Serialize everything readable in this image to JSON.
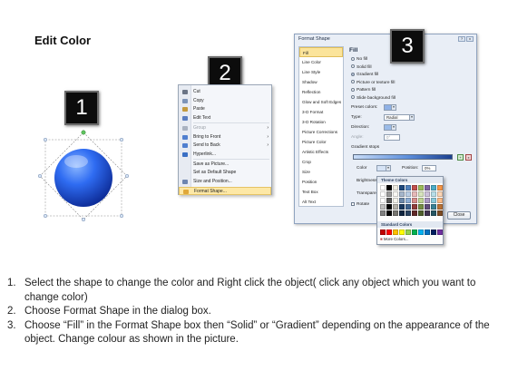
{
  "title": "Edit Color",
  "badges": [
    "1",
    "2",
    "3"
  ],
  "context_menu": {
    "items": [
      {
        "label": "Cut",
        "icon": "scissors-icon",
        "color": "#6a7485"
      },
      {
        "label": "Copy",
        "icon": "copy-icon",
        "color": "#7d94b8"
      },
      {
        "label": "Paste",
        "icon": "paste-icon",
        "color": "#c49a3e"
      },
      {
        "label": "Edit Text",
        "icon": "edit-text-icon",
        "color": "#5a7ec0"
      },
      {
        "label": "Group",
        "icon": "group-icon",
        "color": "#a9b2c0",
        "disabled": true,
        "submenu": true
      },
      {
        "label": "Bring to Front",
        "icon": "bring-front-icon",
        "color": "#4f7fcf",
        "submenu": true
      },
      {
        "label": "Send to Back",
        "icon": "send-back-icon",
        "color": "#4f7fcf",
        "submenu": true
      },
      {
        "label": "Hyperlink...",
        "icon": "hyperlink-icon",
        "color": "#3a6fc4"
      },
      {
        "label": "Save as Picture...",
        "icon": "",
        "color": ""
      },
      {
        "label": "Set as Default Shape",
        "icon": "",
        "color": ""
      },
      {
        "label": "Size and Position...",
        "icon": "size-position-icon",
        "color": "#6d86b0"
      },
      {
        "label": "Format Shape...",
        "icon": "format-shape-icon",
        "color": "#e0a83a",
        "highlighted": true
      }
    ]
  },
  "dialog": {
    "title": "Format Shape",
    "win_buttons": [
      "?",
      "x"
    ],
    "categories": [
      "Fill",
      "Line Color",
      "Line Style",
      "Shadow",
      "Reflection",
      "Glow and Soft Edges",
      "3-D Format",
      "3-D Rotation",
      "Picture Corrections",
      "Picture Color",
      "Artistic Effects",
      "Crop",
      "Size",
      "Position",
      "Text Box",
      "Alt Text"
    ],
    "selected_category": "Fill",
    "fill": {
      "heading": "Fill",
      "options": [
        "No fill",
        "Solid fill",
        "Gradient fill",
        "Picture or texture fill",
        "Pattern fill",
        "Slide background fill"
      ],
      "selected": "Gradient fill",
      "preset_label": "Preset colors:",
      "type_label": "Type:",
      "type_value": "Radial",
      "direction_label": "Direction:",
      "angle_label": "Angle:",
      "angle_value": "0°",
      "stops_label": "Gradient stops",
      "color_label": "Color",
      "position_label": "Position:",
      "position_value": "0%",
      "brightness_label": "Brightness",
      "transparency_label": "Transparen",
      "rotate_label": "Rotate"
    },
    "close_label": "Close"
  },
  "color_popup": {
    "theme_label": "Theme Colors",
    "standard_label": "Standard Colors",
    "more_label": "More Colors...",
    "theme_row": [
      "#ffffff",
      "#000000",
      "#eeece1",
      "#1f497d",
      "#4f81bd",
      "#c0504d",
      "#9bbb59",
      "#8064a2",
      "#4bacc6",
      "#f79646"
    ],
    "standard_row": [
      "#c00000",
      "#ff0000",
      "#ffc000",
      "#ffff00",
      "#92d050",
      "#00b050",
      "#00b0f0",
      "#0070c0",
      "#002060",
      "#7030a0"
    ]
  },
  "instructions": [
    {
      "num": "1.",
      "text": "Select the shape to change the color and Right click the object( click any object which you want to change color)"
    },
    {
      "num": "2.",
      "text": "Choose Format Shape in the dialog box."
    },
    {
      "num": "3.",
      "text": "Choose “Fill” in the Format Shape box then “Solid” or “Gradient” depending on the appearance of the object. Change colour as shown in the picture."
    }
  ]
}
